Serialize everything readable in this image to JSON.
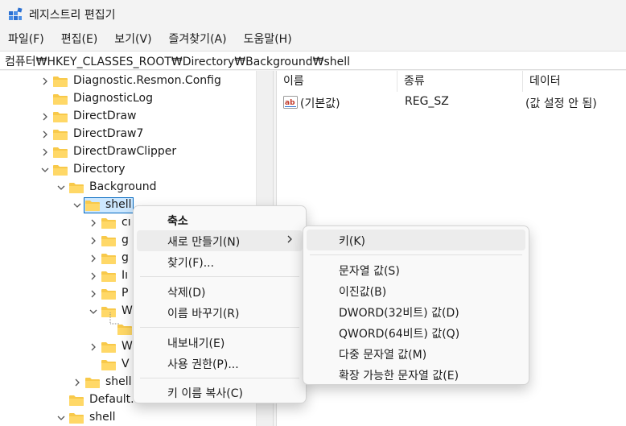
{
  "window": {
    "title": "레지스트리 편집기"
  },
  "menubar": [
    "파일(F)",
    "편집(E)",
    "보기(V)",
    "즐겨찾기(A)",
    "도움말(H)"
  ],
  "address": "컴퓨터₩HKEY_CLASSES_ROOT₩Directory₩Background₩shell",
  "tree": {
    "diag_resmon": "Diagnostic.Resmon.Config",
    "diag_log": "DiagnosticLog",
    "directdraw": "DirectDraw",
    "directdraw7": "DirectDraw7",
    "directdrawclipper": "DirectDrawClipper",
    "directory": "Directory",
    "background": "Background",
    "shell": "shell",
    "child1": "cı",
    "child2": "g",
    "child3": "g",
    "child4": "Iı",
    "child5": "P",
    "child6": "W",
    "child8": "W",
    "child9": "V",
    "shellex_partial": "shell",
    "default_partial": "Default.",
    "shell_bottom": "shell"
  },
  "list": {
    "columns": [
      "이름",
      "종류",
      "데이터"
    ],
    "rows": [
      {
        "name": "(기본값)",
        "type": "REG_SZ",
        "data": "(값 설정 안 됨)"
      }
    ]
  },
  "context_menu": {
    "items": [
      "축소",
      "새로 만들기(N)",
      "찾기(F)...",
      "삭제(D)",
      "이름 바꾸기(R)",
      "내보내기(E)",
      "사용 권한(P)...",
      "키 이름 복사(C)"
    ]
  },
  "submenu": {
    "items": [
      "키(K)",
      "문자열 값(S)",
      "이진값(B)",
      "DWORD(32비트) 값(D)",
      "QWORD(64비트) 값(Q)",
      "다중 문자열 값(M)",
      "확장 가능한 문자열 값(E)"
    ]
  },
  "colors": {
    "folder": "#f8c94a",
    "selection": "#cde8ff",
    "selection_border": "#0067c0",
    "accent": "#0067c0"
  }
}
